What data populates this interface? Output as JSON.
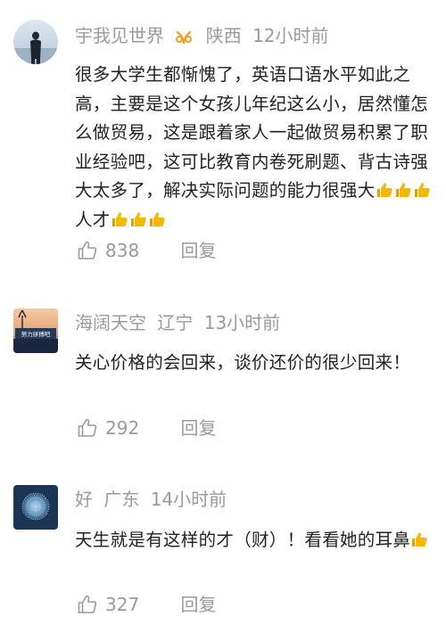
{
  "comments": [
    {
      "username": "宇我见世界",
      "location": "陕西",
      "time": "12小时前",
      "text_main": "很多大学生都惭愧了，英语口语水平如此之高，主要是这个女孩儿年纪这么小，居然懂怎么做贸易，这是跟着家人一起做贸易积累了职业经验吧，这可比教育内卷死刷题、背古诗强大太多了，解决实际问题的能力很强大",
      "text_mid": "人才",
      "likes": "838",
      "reply_label": "回复"
    },
    {
      "username": "海阔天空",
      "location": "辽宁",
      "time": "13小时前",
      "text_main": "关心价格的会回来，谈价还价的很少回来！",
      "likes": "292",
      "reply_label": "回复",
      "avatar_text": "努力拼搏吧"
    },
    {
      "username": "好",
      "location": "广东",
      "time": "14小时前",
      "text_main": "天生就是有这样的才（财）！看看她的耳鼻",
      "likes": "327",
      "reply_label": "回复"
    }
  ],
  "colors": {
    "meta": "#9a9a9a",
    "text": "#222222",
    "vip": "#f0a020",
    "thumb": "#f5b800"
  },
  "icons": {
    "like": "thumbs-up-outline-icon",
    "emoji": "thumbs-up-emoji-icon",
    "vip": "vip-badge-icon"
  }
}
